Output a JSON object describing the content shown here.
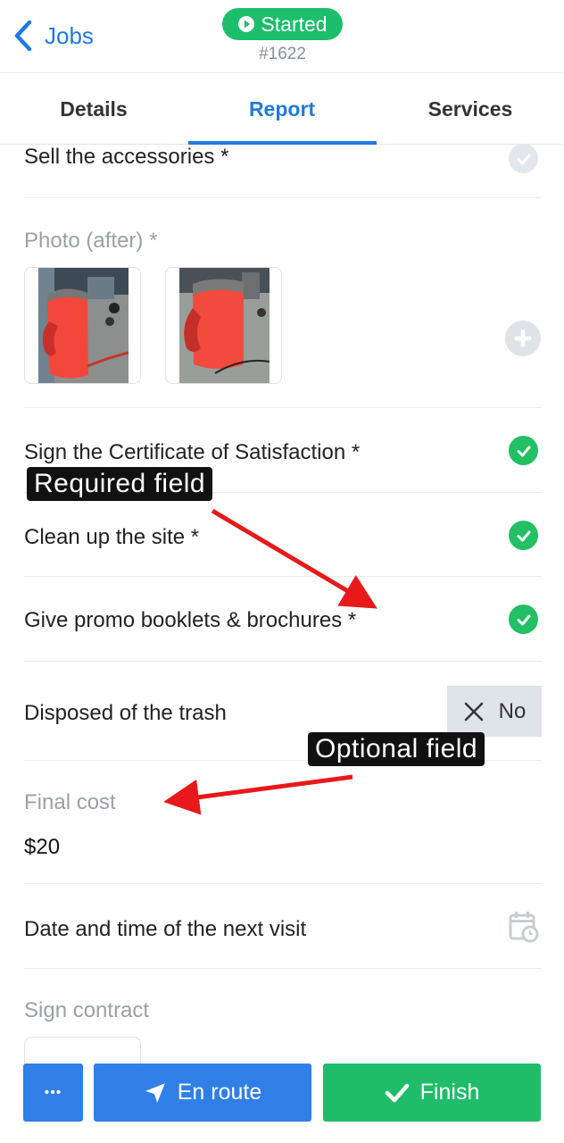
{
  "header": {
    "back_label": "Jobs",
    "status_label": "Started",
    "job_number": "#1622"
  },
  "tabs": [
    {
      "label": "Details",
      "active": false
    },
    {
      "label": "Report",
      "active": true
    },
    {
      "label": "Services",
      "active": false
    }
  ],
  "report": {
    "sell_accessories": {
      "label": "Sell the accessories *",
      "checked": false
    },
    "photo_after": {
      "label": "Photo (after) *",
      "photo_count": 2
    },
    "sign_certificate": {
      "label": "Sign the Certificate of Satisfaction *",
      "checked": true
    },
    "clean_site": {
      "label": "Clean up the site *",
      "checked": true
    },
    "promo_booklets": {
      "label": "Give promo booklets & brochures *",
      "checked": true
    },
    "disposed_trash": {
      "label": "Disposed of the trash",
      "toggle_label": "No"
    },
    "final_cost": {
      "label": "Final cost",
      "value": "$20"
    },
    "next_visit": {
      "label": "Date and time of the next visit"
    },
    "sign_contract": {
      "label": "Sign contract"
    }
  },
  "footer": {
    "more_label": "•••",
    "enroute_label": "En route",
    "finish_label": "Finish"
  },
  "annotations": {
    "required": "Required field",
    "optional": "Optional field"
  },
  "colors": {
    "accent": "#1f7ae0",
    "success": "#1cbe6b",
    "callout_arrow": "#e8191b"
  }
}
